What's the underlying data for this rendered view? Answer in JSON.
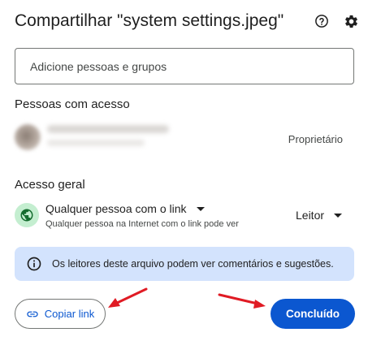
{
  "dialog": {
    "title": "Compartilhar \"system settings.jpeg\"",
    "icons": {
      "help": "help-icon",
      "settings": "gear-icon"
    }
  },
  "add_people": {
    "placeholder": "Adicione pessoas e grupos"
  },
  "people_with_access": {
    "title": "Pessoas com acesso",
    "people": [
      {
        "role": "Proprietário"
      }
    ]
  },
  "general_access": {
    "title": "Acesso geral",
    "icon": "globe-icon",
    "access_level": "Qualquer pessoa com o link",
    "description": "Qualquer pessoa na Internet com o link pode ver",
    "role": "Leitor"
  },
  "info_banner": {
    "icon": "info-icon",
    "text": "Os leitores deste arquivo podem ver comentários e sugestões."
  },
  "buttons": {
    "copy_link": "Copiar link",
    "copy_link_icon": "link-icon",
    "done": "Concluído"
  },
  "annotations": {
    "arrow_color": "#e01b24"
  },
  "colors": {
    "accent": "#0b57d0",
    "banner_bg": "#d3e3fd",
    "globe_bg": "#c4eed0"
  }
}
